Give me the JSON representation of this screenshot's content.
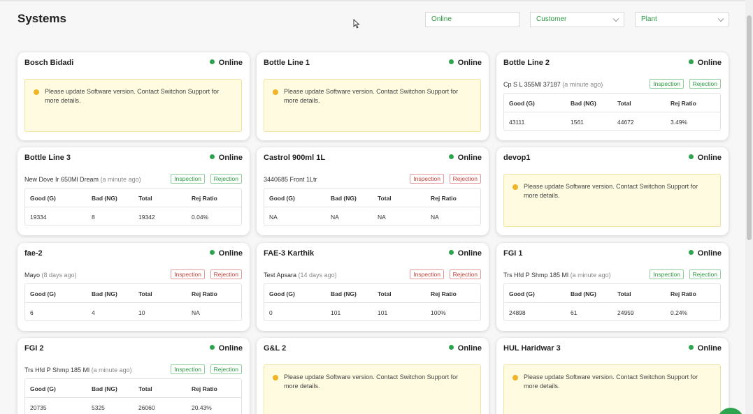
{
  "header": {
    "title": "Systems",
    "status_filter": "Online",
    "customer_filter": "Customer",
    "plant_filter": "Plant"
  },
  "colors": {
    "online": "#2ea44f",
    "warning_bg": "#fffbe0",
    "accent_green": "#2e9a43",
    "accent_red": "#c9403a"
  },
  "columns": [
    "Good (G)",
    "Bad (NG)",
    "Total",
    "Rej Ratio"
  ],
  "tags": {
    "inspection": "Inspection",
    "rejection": "Rejection"
  },
  "warning_text": "Please update Software version. Contact Switchon Support for more details.",
  "cards": [
    {
      "name": "Bosch Bidadi",
      "status": "Online",
      "type": "warning"
    },
    {
      "name": "Bottle Line 1",
      "status": "Online",
      "type": "warning"
    },
    {
      "name": "Bottle Line 2",
      "status": "Online",
      "type": "table",
      "product": "Cp S L 355Ml 37187",
      "ago": "(a minute ago)",
      "tag_color": "green",
      "values": [
        "43111",
        "1561",
        "44672",
        "3.49%"
      ]
    },
    {
      "name": "Bottle Line 3",
      "status": "Online",
      "type": "table",
      "product": "New Dove Ir 650Ml Dream",
      "ago": "(a minute ago)",
      "tag_color": "green",
      "values": [
        "19334",
        "8",
        "19342",
        "0.04%"
      ]
    },
    {
      "name": "Castrol 900ml 1L",
      "status": "Online",
      "type": "table",
      "product": "3440685 Front 1Ltr",
      "ago": "",
      "tag_color": "red",
      "values": [
        "NA",
        "NA",
        "NA",
        "NA"
      ]
    },
    {
      "name": "devop1",
      "status": "Online",
      "type": "warning"
    },
    {
      "name": "fae-2",
      "status": "Online",
      "type": "table",
      "product": "Mayo",
      "ago": "(8 days ago)",
      "tag_color": "red",
      "values": [
        "6",
        "4",
        "10",
        "NA"
      ]
    },
    {
      "name": "FAE-3 Karthik",
      "status": "Online",
      "type": "table",
      "product": "Test Apsara",
      "ago": "(14 days ago)",
      "tag_color": "red",
      "values": [
        "0",
        "101",
        "101",
        "100%"
      ]
    },
    {
      "name": "FGI 1",
      "status": "Online",
      "type": "table",
      "product": "Trs Hfd P Shmp 185 Ml",
      "ago": "(a minute ago)",
      "tag_color": "green",
      "values": [
        "24898",
        "61",
        "24959",
        "0.24%"
      ]
    },
    {
      "name": "FGI 2",
      "status": "Online",
      "type": "table",
      "product": "Trs Hfd P Shmp 185 Ml",
      "ago": "(a minute ago)",
      "tag_color": "green",
      "values": [
        "20735",
        "5325",
        "26060",
        "20.43%"
      ]
    },
    {
      "name": "G&L 2",
      "status": "Online",
      "type": "warning"
    },
    {
      "name": "HUL Haridwar 3",
      "status": "Online",
      "type": "warning"
    }
  ]
}
